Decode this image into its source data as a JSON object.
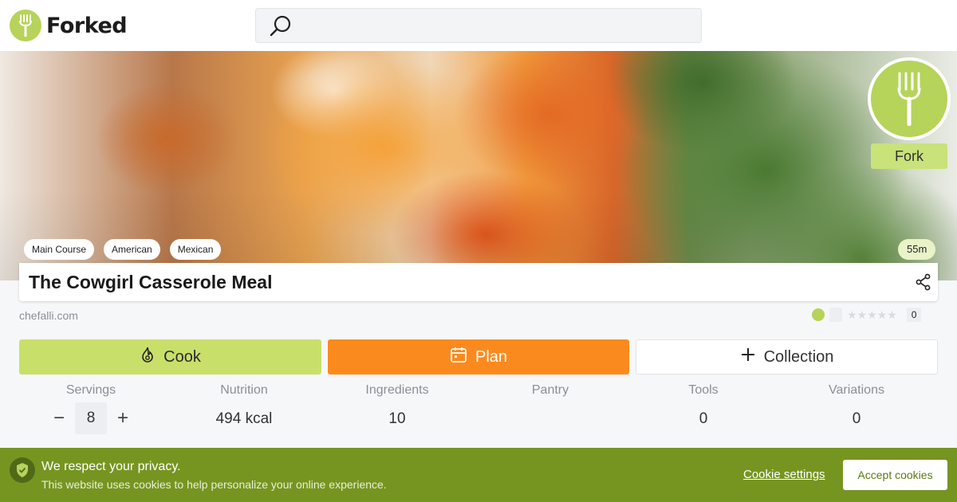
{
  "header": {
    "logo_text": "Forked",
    "search_placeholder": ""
  },
  "hero": {
    "fork_label": "Fork",
    "tags": [
      "Main Course",
      "American",
      "Mexican"
    ],
    "time": "55m"
  },
  "recipe": {
    "title": "The Cowgirl Casserole Meal",
    "source": "chefalli.com",
    "rating_count": "0",
    "stars": "★★★★★"
  },
  "actions": {
    "cook": "Cook",
    "plan": "Plan",
    "collection": "Collection"
  },
  "stats": {
    "servings_label": "Servings",
    "servings_value": "8",
    "minus": "−",
    "plus": "+",
    "nutrition_label": "Nutrition",
    "nutrition_value": "494 kcal",
    "ingredients_label": "Ingredients",
    "ingredients_value": "10",
    "pantry_label": "Pantry",
    "pantry_value": "",
    "tools_label": "Tools",
    "tools_value": "0",
    "variations_label": "Variations",
    "variations_value": "0"
  },
  "cookie": {
    "title": "We respect your privacy.",
    "text": "This website uses cookies to help personalize your online experience.",
    "settings": "Cookie settings",
    "accept": "Accept cookies"
  },
  "colors": {
    "brand_green": "#b6d35a",
    "cook_green": "#c8e06a",
    "plan_orange": "#fb8a1e",
    "banner_green": "#769520"
  }
}
